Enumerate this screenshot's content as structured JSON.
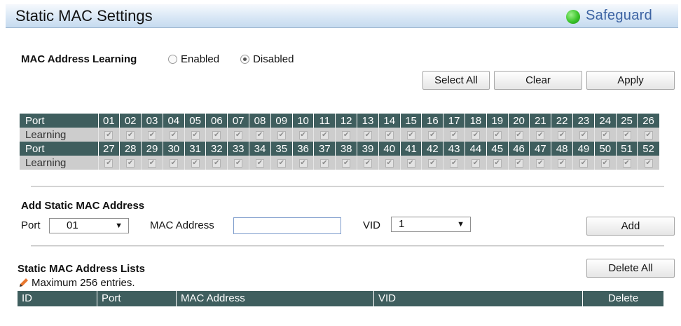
{
  "header": {
    "title": "Static MAC Settings",
    "safeguard_label": "Safeguard",
    "safeguard_color": "#3bc42a"
  },
  "learning": {
    "label": "MAC Address Learning",
    "options": [
      {
        "label": "Enabled",
        "selected": false
      },
      {
        "label": "Disabled",
        "selected": true
      }
    ]
  },
  "buttons": {
    "select_all": "Select All",
    "clear": "Clear",
    "apply": "Apply",
    "add": "Add",
    "delete_all": "Delete All"
  },
  "port_table": {
    "port_label": "Port",
    "learning_label": "Learning",
    "row1": [
      "01",
      "02",
      "03",
      "04",
      "05",
      "06",
      "07",
      "08",
      "09",
      "10",
      "11",
      "12",
      "13",
      "14",
      "15",
      "16",
      "17",
      "18",
      "19",
      "20",
      "21",
      "22",
      "23",
      "24",
      "25",
      "26"
    ],
    "row2": [
      "27",
      "28",
      "29",
      "30",
      "31",
      "32",
      "33",
      "34",
      "35",
      "36",
      "37",
      "38",
      "39",
      "40",
      "41",
      "42",
      "43",
      "44",
      "45",
      "46",
      "47",
      "48",
      "49",
      "50",
      "51",
      "52"
    ],
    "learning_checked": true
  },
  "add_section": {
    "title": "Add Static MAC Address",
    "port_label": "Port",
    "port_value": "01",
    "mac_label": "MAC Address",
    "mac_value": "",
    "vid_label": "VID",
    "vid_value": "1"
  },
  "list_section": {
    "title": "Static MAC Address Lists",
    "note": "Maximum 256 entries.",
    "columns": [
      "ID",
      "Port",
      "MAC Address",
      "VID",
      "Delete"
    ]
  }
}
